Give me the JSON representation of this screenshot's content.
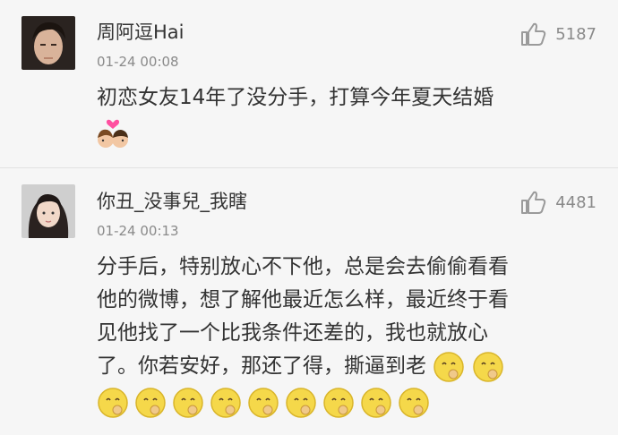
{
  "comments": [
    {
      "username": "周阿逗Hai",
      "time": "01-24 00:08",
      "likes": "5187",
      "text": "初恋女友14年了没分手，打算今年夏天结婚",
      "emoji": "couple-kiss-emoji"
    },
    {
      "username": "你丑_没事兒_我瞎",
      "time": "01-24 00:13",
      "likes": "4481",
      "text_lines": [
        "分手后，特别放心不下他，总是会去偷偷看看",
        "他的微博，想了解他最近怎么样，最近终于看",
        "见他找了一个比我条件还差的，我也就放心",
        "了。你若安好，那还了得，撕逼到老"
      ],
      "emoji": "clap-face-emoji",
      "emoji_count": 11
    }
  ],
  "colors": {
    "background": "#f6f6f6",
    "text": "#333333",
    "muted": "#8a8a8a",
    "divider": "#e2e2e2",
    "emoji_yellow": "#f5d84a"
  }
}
